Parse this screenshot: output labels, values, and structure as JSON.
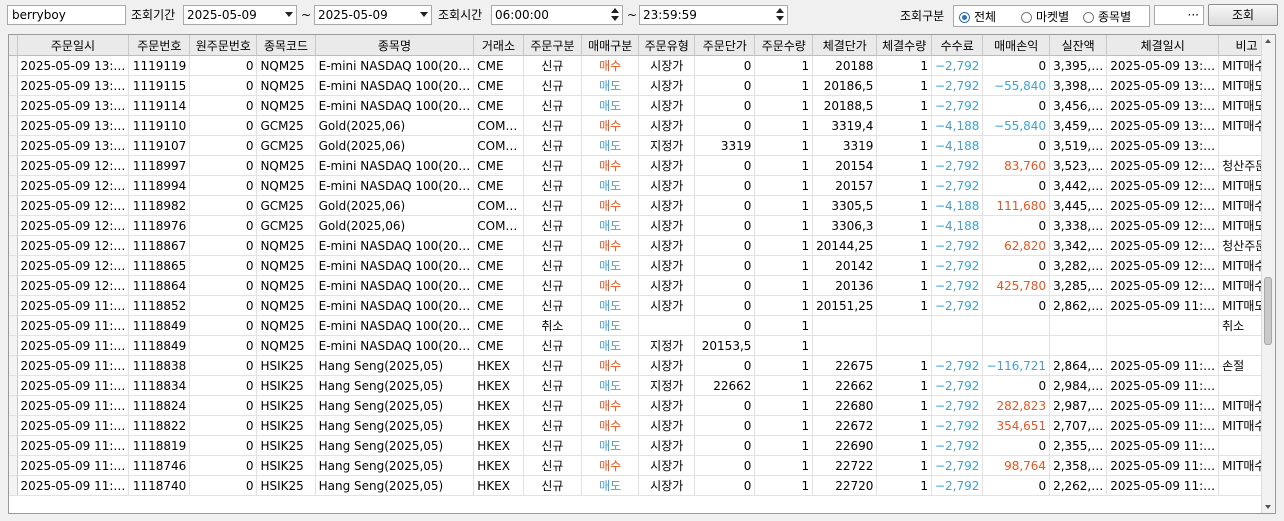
{
  "toolbar": {
    "account": "berryboy",
    "period_label": "조회기간",
    "date_from": "2025-05-09",
    "tilde1": "~",
    "date_to": "2025-05-09",
    "time_label": "조회시간",
    "time_from": "06:00:00",
    "tilde2": "~",
    "time_to": "23:59:59",
    "category_label": "조회구분",
    "radio_all": "전체",
    "radio_market": "마켓별",
    "radio_item": "종목별",
    "item_value": "···",
    "search_button": "조회"
  },
  "colors": {
    "buy": "#e8541e",
    "sell": "#3ba3d6"
  },
  "table": {
    "columns": [
      "주문일시",
      "주문번호",
      "원주문번호",
      "종목코드",
      "종목명",
      "거래소",
      "주문구분",
      "매매구분",
      "주문유형",
      "주문단가",
      "주문수량",
      "체결단가",
      "체결수량",
      "수수료",
      "매매손익",
      "실잔액",
      "체결일시",
      "비고"
    ],
    "rows": [
      [
        "2025-05-09 13:…",
        "1119119",
        "0",
        "NQM25",
        "E-mini NASDAQ 100(20…",
        "CME",
        "신규",
        "매수",
        "시장가",
        "0",
        "1",
        "20188",
        "1",
        "−2,792",
        "0",
        "3,395,…",
        "2025-05-09 13:…",
        "MIT매수"
      ],
      [
        "2025-05-09 13:…",
        "1119115",
        "0",
        "NQM25",
        "E-mini NASDAQ 100(20…",
        "CME",
        "신규",
        "매도",
        "시장가",
        "0",
        "1",
        "20186,5",
        "1",
        "−2,792",
        "−55,840",
        "3,398,…",
        "2025-05-09 13:…",
        "MIT매도"
      ],
      [
        "2025-05-09 13:…",
        "1119114",
        "0",
        "NQM25",
        "E-mini NASDAQ 100(20…",
        "CME",
        "신규",
        "매도",
        "시장가",
        "0",
        "1",
        "20188,5",
        "1",
        "−2,792",
        "0",
        "3,456,…",
        "2025-05-09 13:…",
        "MIT매도"
      ],
      [
        "2025-05-09 13:…",
        "1119110",
        "0",
        "GCM25",
        "Gold(2025,06)",
        "COM…",
        "신규",
        "매수",
        "시장가",
        "0",
        "1",
        "3319,4",
        "1",
        "−4,188",
        "−55,840",
        "3,459,…",
        "2025-05-09 13:…",
        "MIT매수"
      ],
      [
        "2025-05-09 13:…",
        "1119107",
        "0",
        "GCM25",
        "Gold(2025,06)",
        "COM…",
        "신규",
        "매도",
        "지정가",
        "3319",
        "1",
        "3319",
        "1",
        "−4,188",
        "0",
        "3,519,…",
        "2025-05-09 13:…",
        ""
      ],
      [
        "2025-05-09 12:…",
        "1118997",
        "0",
        "NQM25",
        "E-mini NASDAQ 100(20…",
        "CME",
        "신규",
        "매수",
        "시장가",
        "0",
        "1",
        "20154",
        "1",
        "−2,792",
        "83,760",
        "3,523,…",
        "2025-05-09 12:…",
        "청산주문"
      ],
      [
        "2025-05-09 12:…",
        "1118994",
        "0",
        "NQM25",
        "E-mini NASDAQ 100(20…",
        "CME",
        "신규",
        "매도",
        "시장가",
        "0",
        "1",
        "20157",
        "1",
        "−2,792",
        "0",
        "3,442,…",
        "2025-05-09 12:…",
        "MIT매도"
      ],
      [
        "2025-05-09 12:…",
        "1118982",
        "0",
        "GCM25",
        "Gold(2025,06)",
        "COM…",
        "신규",
        "매수",
        "시장가",
        "0",
        "1",
        "3305,5",
        "1",
        "−4,188",
        "111,680",
        "3,445,…",
        "2025-05-09 12:…",
        "MIT매수"
      ],
      [
        "2025-05-09 12:…",
        "1118976",
        "0",
        "GCM25",
        "Gold(2025,06)",
        "COM…",
        "신규",
        "매도",
        "시장가",
        "0",
        "1",
        "3306,3",
        "1",
        "−4,188",
        "0",
        "3,338,…",
        "2025-05-09 12:…",
        "MIT매도"
      ],
      [
        "2025-05-09 12:…",
        "1118867",
        "0",
        "NQM25",
        "E-mini NASDAQ 100(20…",
        "CME",
        "신규",
        "매수",
        "시장가",
        "0",
        "1",
        "20144,25",
        "1",
        "−2,792",
        "62,820",
        "3,342,…",
        "2025-05-09 12:…",
        "청산주문"
      ],
      [
        "2025-05-09 12:…",
        "1118865",
        "0",
        "NQM25",
        "E-mini NASDAQ 100(20…",
        "CME",
        "신규",
        "매도",
        "시장가",
        "0",
        "1",
        "20142",
        "1",
        "−2,792",
        "0",
        "3,282,…",
        "2025-05-09 12:…",
        "MIT매수"
      ],
      [
        "2025-05-09 12:…",
        "1118864",
        "0",
        "NQM25",
        "E-mini NASDAQ 100(20…",
        "CME",
        "신규",
        "매수",
        "시장가",
        "0",
        "1",
        "20136",
        "1",
        "−2,792",
        "425,780",
        "3,285,…",
        "2025-05-09 12:…",
        "MIT매수"
      ],
      [
        "2025-05-09 11:…",
        "1118852",
        "0",
        "NQM25",
        "E-mini NASDAQ 100(20…",
        "CME",
        "신규",
        "매도",
        "시장가",
        "0",
        "1",
        "20151,25",
        "1",
        "−2,792",
        "0",
        "2,862,…",
        "2025-05-09 11:…",
        "MIT매도"
      ],
      [
        "2025-05-09 11:…",
        "1118849",
        "0",
        "NQM25",
        "E-mini NASDAQ 100(20…",
        "CME",
        "취소",
        "매도",
        "",
        "0",
        "1",
        "",
        "",
        "",
        "",
        "",
        "",
        "취소"
      ],
      [
        "2025-05-09 11:…",
        "1118849",
        "0",
        "NQM25",
        "E-mini NASDAQ 100(20…",
        "CME",
        "신규",
        "매도",
        "지정가",
        "20153,5",
        "1",
        "",
        "",
        "",
        "",
        "",
        "",
        ""
      ],
      [
        "2025-05-09 11:…",
        "1118838",
        "0",
        "HSIK25",
        "Hang Seng(2025,05)",
        "HKEX",
        "신규",
        "매수",
        "시장가",
        "0",
        "1",
        "22675",
        "1",
        "−2,792",
        "−116,721",
        "2,864,…",
        "2025-05-09 11:…",
        "손절"
      ],
      [
        "2025-05-09 11:…",
        "1118834",
        "0",
        "HSIK25",
        "Hang Seng(2025,05)",
        "HKEX",
        "신규",
        "매도",
        "지정가",
        "22662",
        "1",
        "22662",
        "1",
        "−2,792",
        "0",
        "2,984,…",
        "2025-05-09 11:…",
        ""
      ],
      [
        "2025-05-09 11:…",
        "1118824",
        "0",
        "HSIK25",
        "Hang Seng(2025,05)",
        "HKEX",
        "신규",
        "매수",
        "시장가",
        "0",
        "1",
        "22680",
        "1",
        "−2,792",
        "282,823",
        "2,987,…",
        "2025-05-09 11:…",
        "MIT매수"
      ],
      [
        "2025-05-09 11:…",
        "1118822",
        "0",
        "HSIK25",
        "Hang Seng(2025,05)",
        "HKEX",
        "신규",
        "매수",
        "시장가",
        "0",
        "1",
        "22672",
        "1",
        "−2,792",
        "354,651",
        "2,707,…",
        "2025-05-09 11:…",
        "MIT매수"
      ],
      [
        "2025-05-09 11:…",
        "1118819",
        "0",
        "HSIK25",
        "Hang Seng(2025,05)",
        "HKEX",
        "신규",
        "매도",
        "시장가",
        "0",
        "1",
        "22690",
        "1",
        "−2,792",
        "0",
        "2,355,…",
        "2025-05-09 11:…",
        ""
      ],
      [
        "2025-05-09 11:…",
        "1118746",
        "0",
        "HSIK25",
        "Hang Seng(2025,05)",
        "HKEX",
        "신규",
        "매수",
        "시장가",
        "0",
        "1",
        "22722",
        "1",
        "−2,792",
        "98,764",
        "2,358,…",
        "2025-05-09 11:…",
        "MIT매수"
      ],
      [
        "2025-05-09 11:…",
        "1118740",
        "0",
        "HSIK25",
        "Hang Seng(2025,05)",
        "HKEX",
        "신규",
        "매도",
        "시장가",
        "0",
        "1",
        "22720",
        "1",
        "−2,792",
        "0",
        "2,262,…",
        "2025-05-09 11:…",
        ""
      ]
    ]
  }
}
